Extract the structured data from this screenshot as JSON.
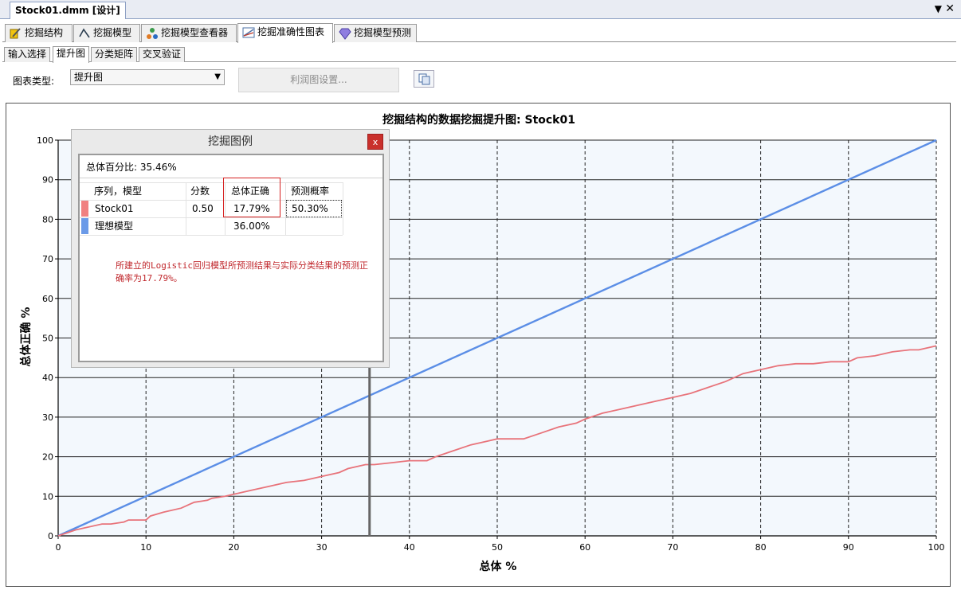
{
  "document": {
    "tab_title": "Stock01.dmm [设计]",
    "pin_glyph": "▼",
    "close_glyph": "✕"
  },
  "main_tabs": [
    {
      "label": "挖掘结构",
      "icon": "mining-structure-icon"
    },
    {
      "label": "挖掘模型",
      "icon": "mining-model-icon"
    },
    {
      "label": "挖掘模型查看器",
      "icon": "model-viewer-icon"
    },
    {
      "label": "挖掘准确性图表",
      "icon": "accuracy-chart-icon",
      "active": true
    },
    {
      "label": "挖掘模型预测",
      "icon": "prediction-diamond-icon"
    }
  ],
  "sub_tabs": [
    {
      "label": "输入选择"
    },
    {
      "label": "提升图",
      "active": true
    },
    {
      "label": "分类矩阵"
    },
    {
      "label": "交叉验证"
    }
  ],
  "toolbar": {
    "chart_type_label": "图表类型:",
    "chart_type_value": "提升图",
    "profit_settings_label": "利润图设置...",
    "copy_icon": "copy-icon"
  },
  "chart_data": {
    "type": "line",
    "title": "挖掘结构的数据挖掘提升图: Stock01",
    "xlabel": "总体 %",
    "ylabel": "总体正确 %",
    "xlim": [
      0,
      100
    ],
    "ylim": [
      0,
      100
    ],
    "x_ticks": [
      0,
      10,
      20,
      30,
      40,
      50,
      60,
      70,
      80,
      90,
      100
    ],
    "y_ticks": [
      0,
      10,
      20,
      30,
      40,
      50,
      60,
      70,
      80,
      90,
      100
    ],
    "grid": true,
    "cursor_x": 35.46,
    "series": [
      {
        "name": "理想模型",
        "color": "#5b8ee6",
        "x": [
          0,
          100
        ],
        "y": [
          0,
          100
        ]
      },
      {
        "name": "Stock01",
        "color": "#e8737a",
        "x": [
          0,
          2,
          5,
          6,
          7.5,
          8,
          10,
          10.5,
          12,
          14,
          15,
          15.5,
          17,
          17.5,
          19,
          20,
          22,
          24,
          25,
          26,
          28,
          29,
          30,
          32,
          33,
          34,
          35,
          36,
          38,
          40,
          42,
          43,
          45,
          47,
          49,
          50,
          53,
          55,
          57,
          59,
          60,
          62,
          64,
          66,
          68,
          70,
          72,
          74,
          76,
          78,
          80,
          82,
          84,
          86,
          88,
          90,
          91,
          93,
          95,
          97,
          98,
          100
        ],
        "y": [
          0,
          1.5,
          3,
          3,
          3.5,
          4,
          4,
          5,
          6,
          7,
          8,
          8.5,
          9,
          9.5,
          10,
          10.5,
          11.5,
          12.5,
          13,
          13.5,
          14,
          14.5,
          15,
          16,
          17,
          17.5,
          18,
          18,
          18.5,
          19,
          19,
          20,
          21.5,
          23,
          24,
          24.5,
          24.5,
          26,
          27.5,
          28.5,
          29.5,
          31,
          32,
          33,
          34,
          35,
          36,
          37.5,
          39,
          41,
          42,
          43,
          43.5,
          43.5,
          44,
          44,
          45,
          45.5,
          46.5,
          47,
          47,
          48
        ]
      }
    ]
  },
  "legend": {
    "title": "挖掘图例",
    "close_label": "x",
    "total_percentage": "总体百分比: 35.46%",
    "columns": [
      "序列，模型",
      "分数",
      "总体正确",
      "预测概率"
    ],
    "rows": [
      {
        "name": "Stock01",
        "score": "0.50",
        "correct": "17.79%",
        "probability": "50.30%",
        "color": "#f08080"
      },
      {
        "name": "理想模型",
        "score": "",
        "correct": "36.00%",
        "probability": "",
        "color": "#6b9ae8"
      }
    ],
    "annotation": "所建立的Logistic回归模型所预测结果与实际分类结果的预测正确率为17.79%。"
  }
}
